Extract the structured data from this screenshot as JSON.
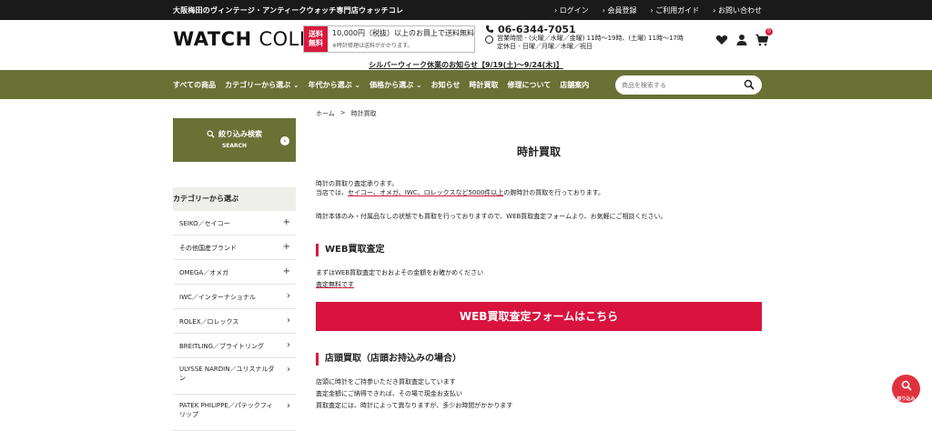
{
  "topbar": {
    "tagline": "大阪梅田のヴィンテージ・アンティークウォッチ専門店ウォッチコレ",
    "links": [
      "ログイン",
      "会員登録",
      "ご利用ガイド",
      "お問い合わせ"
    ]
  },
  "header": {
    "logo_bold": "WATCH",
    "logo_thin": "COLLE",
    "shipping_badge": "送料\n無料",
    "shipping_main": "10,000円（税抜）以上のお買上で送料無料",
    "shipping_note": "※時計修理は送料がかかります。",
    "phone": "06-6344-7051",
    "hours": "営業時間 - (火曜／水曜／金曜) 11時～19時、(土曜) 11時～17時",
    "closed": "定休日 - 日曜／月曜／木曜／祝日",
    "cart_count": "0"
  },
  "notice": "シルバーウィーク休業のお知らせ【9/19(土)～9/24(木)】",
  "nav": {
    "items": [
      "すべての商品",
      "カテゴリーから選ぶ ⌄",
      "年代から選ぶ ⌄",
      "価格から選ぶ ⌄",
      "お知らせ",
      "時計買取",
      "修理について",
      "店舗案内"
    ],
    "search_placeholder": "商品を検索する"
  },
  "sidebar": {
    "filter_title": "絞り込み検索",
    "filter_sub": "SEARCH",
    "category_heading": "カテゴリーから選ぶ",
    "categories": [
      {
        "label": "SEIKO／セイコー",
        "indicator": "+"
      },
      {
        "label": "その他国産ブランド",
        "indicator": "+"
      },
      {
        "label": "OMEGA／オメガ",
        "indicator": "+"
      },
      {
        "label": "IWC／インターナショナル",
        "indicator": "›"
      },
      {
        "label": "ROLEX／ロレックス",
        "indicator": "›"
      },
      {
        "label": "BREITLING／ブライトリング",
        "indicator": "›"
      },
      {
        "label": "ULYSSE NARDIN／ユリスナルダン",
        "indicator": "›"
      },
      {
        "label": "PATEK PHILIPPE／パテックフィリップ",
        "indicator": "›"
      }
    ]
  },
  "main": {
    "breadcrumb": [
      "ホーム",
      ">",
      "時計買取"
    ],
    "title": "時計買取",
    "intro_line1": "時計の買取り査定承ります。",
    "intro_line2_a": "当店では、",
    "intro_line2_u": "セイコー、オメガ、IWC、ロレックスなど5000件以上",
    "intro_line2_b": "の腕時計の買取を行っております。",
    "intro_line3": "時計本体のみ・付属品なしの状態でも買取を行っておりますので、WEB買取査定フォームより、お気軽にご相談ください。",
    "web_heading": "WEB買取査定",
    "web_text1": "まずはWEB買取査定でおおよその金額をお確かめください",
    "web_text2": "査定無料です",
    "web_button": "WEB買取査定フォームはこちら",
    "store_heading": "店頭買取（店頭お持込みの場合）",
    "store_lines": [
      "店頭に時計をご持参いただき買取査定しています",
      "査定金額にご納得できれば、その場で現金お支払い",
      "買取査定には、時計によって異なりますが、多少お時間がかかります"
    ]
  },
  "float_button": "絞り込み",
  "colors": {
    "nav_green": "#6a7135",
    "accent_red": "#d9193e",
    "topbar": "#1a1a1a"
  }
}
